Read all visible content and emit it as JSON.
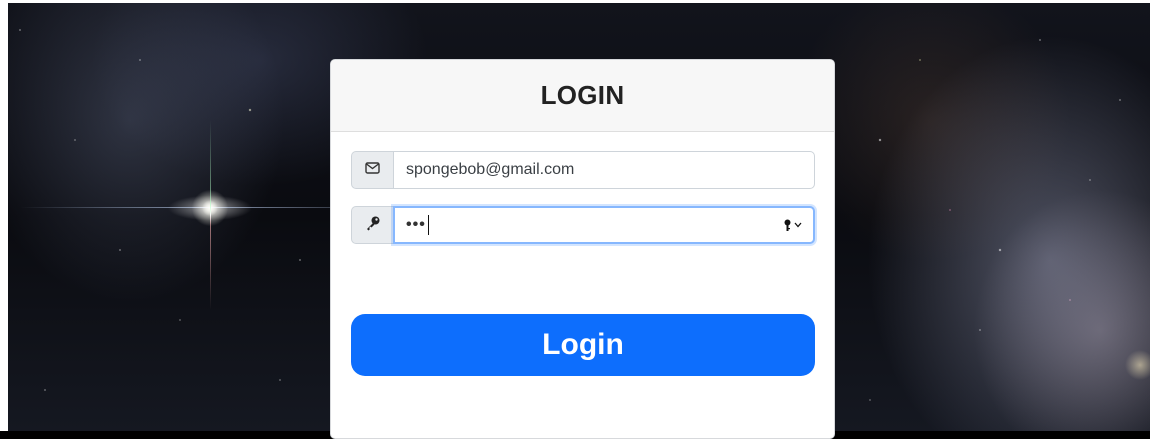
{
  "login": {
    "title": "LOGIN",
    "email": {
      "value": "spongebob@gmail.com",
      "icon": "envelope-icon"
    },
    "password": {
      "masked_value": "•••",
      "icon": "key-icon",
      "autofill_icon": "password-key-dropdown-icon"
    },
    "submit_label": "Login"
  },
  "colors": {
    "primary_button": "#0d6efd",
    "focus_ring": "#86b7fe",
    "header_bg": "#f7f7f7"
  }
}
